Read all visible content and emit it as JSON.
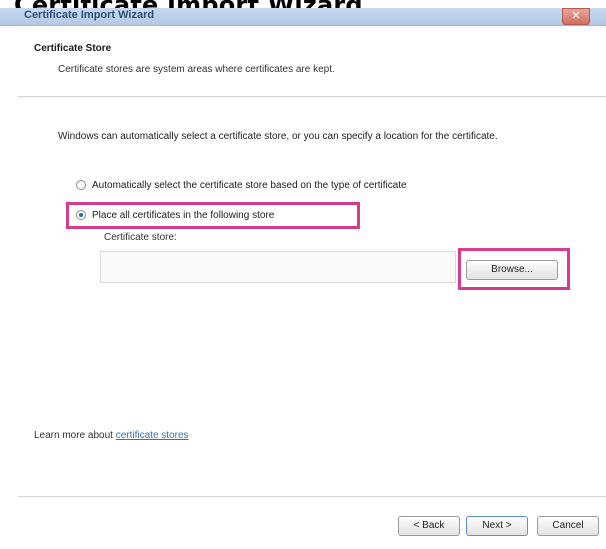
{
  "caption": "Certificate Import Wizard",
  "window": {
    "title": "Certificate Import Wizard",
    "close_glyph": "✕"
  },
  "header": {
    "title": "Certificate Store",
    "description": "Certificate stores are system areas where certificates are kept."
  },
  "body": {
    "intro": "Windows can automatically select a certificate store, or you can specify a location for the certificate.",
    "options": [
      {
        "label": "Automatically select the certificate store based on the type of certificate",
        "selected": false
      },
      {
        "label": "Place all certificates in the following store",
        "selected": true
      }
    ],
    "store_label": "Certificate store:",
    "store_value": "",
    "browse_label": "Browse..."
  },
  "learn_more": {
    "prefix": "Learn more about ",
    "link": "certificate stores"
  },
  "footer": {
    "back_label": "< Back",
    "next_label": "Next >",
    "cancel_label": "Cancel"
  },
  "colors": {
    "highlight": "#d63b8c",
    "titlebar": "#b3c9e6",
    "link": "#3a6fb8"
  }
}
